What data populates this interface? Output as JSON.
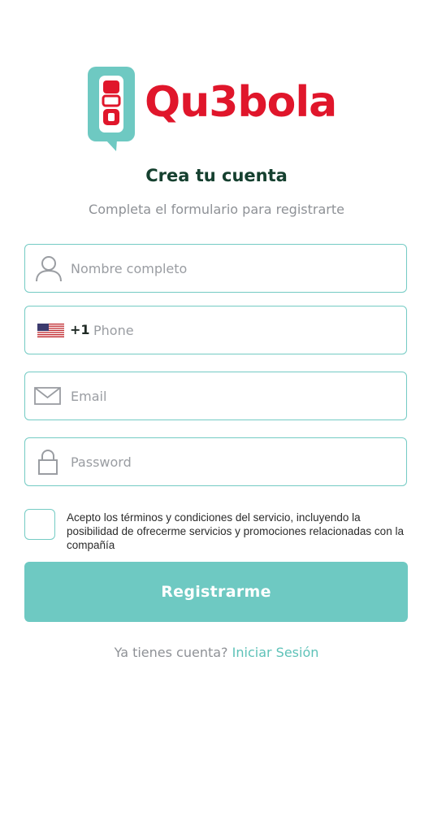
{
  "brand": {
    "name": "Qu3bola",
    "primary_color": "#e0162b",
    "accent_color": "#6ec9c2",
    "logo_icon": "qu3bola-logo-icon"
  },
  "header": {
    "title": "Crea tu cuenta",
    "subtitle": "Completa el formulario para registrarte"
  },
  "form": {
    "name": {
      "placeholder": "Nombre completo",
      "value": "",
      "icon": "user-icon"
    },
    "phone": {
      "country_flag": "us-flag-icon",
      "dial_code": "+1",
      "placeholder": "Phone",
      "value": ""
    },
    "email": {
      "placeholder": "Email",
      "value": "",
      "icon": "mail-icon"
    },
    "password": {
      "placeholder": "Password",
      "value": "",
      "icon": "lock-icon"
    },
    "terms": {
      "checked": false,
      "text": "Acepto los términos y condiciones del servicio, incluyendo la posibilidad de ofrecerme servicios y promociones relacionadas con la compañía"
    },
    "submit_label": "Registrarme"
  },
  "footer": {
    "prompt": "Ya tienes cuenta? ",
    "login_link": "Iniciar Sesión"
  }
}
